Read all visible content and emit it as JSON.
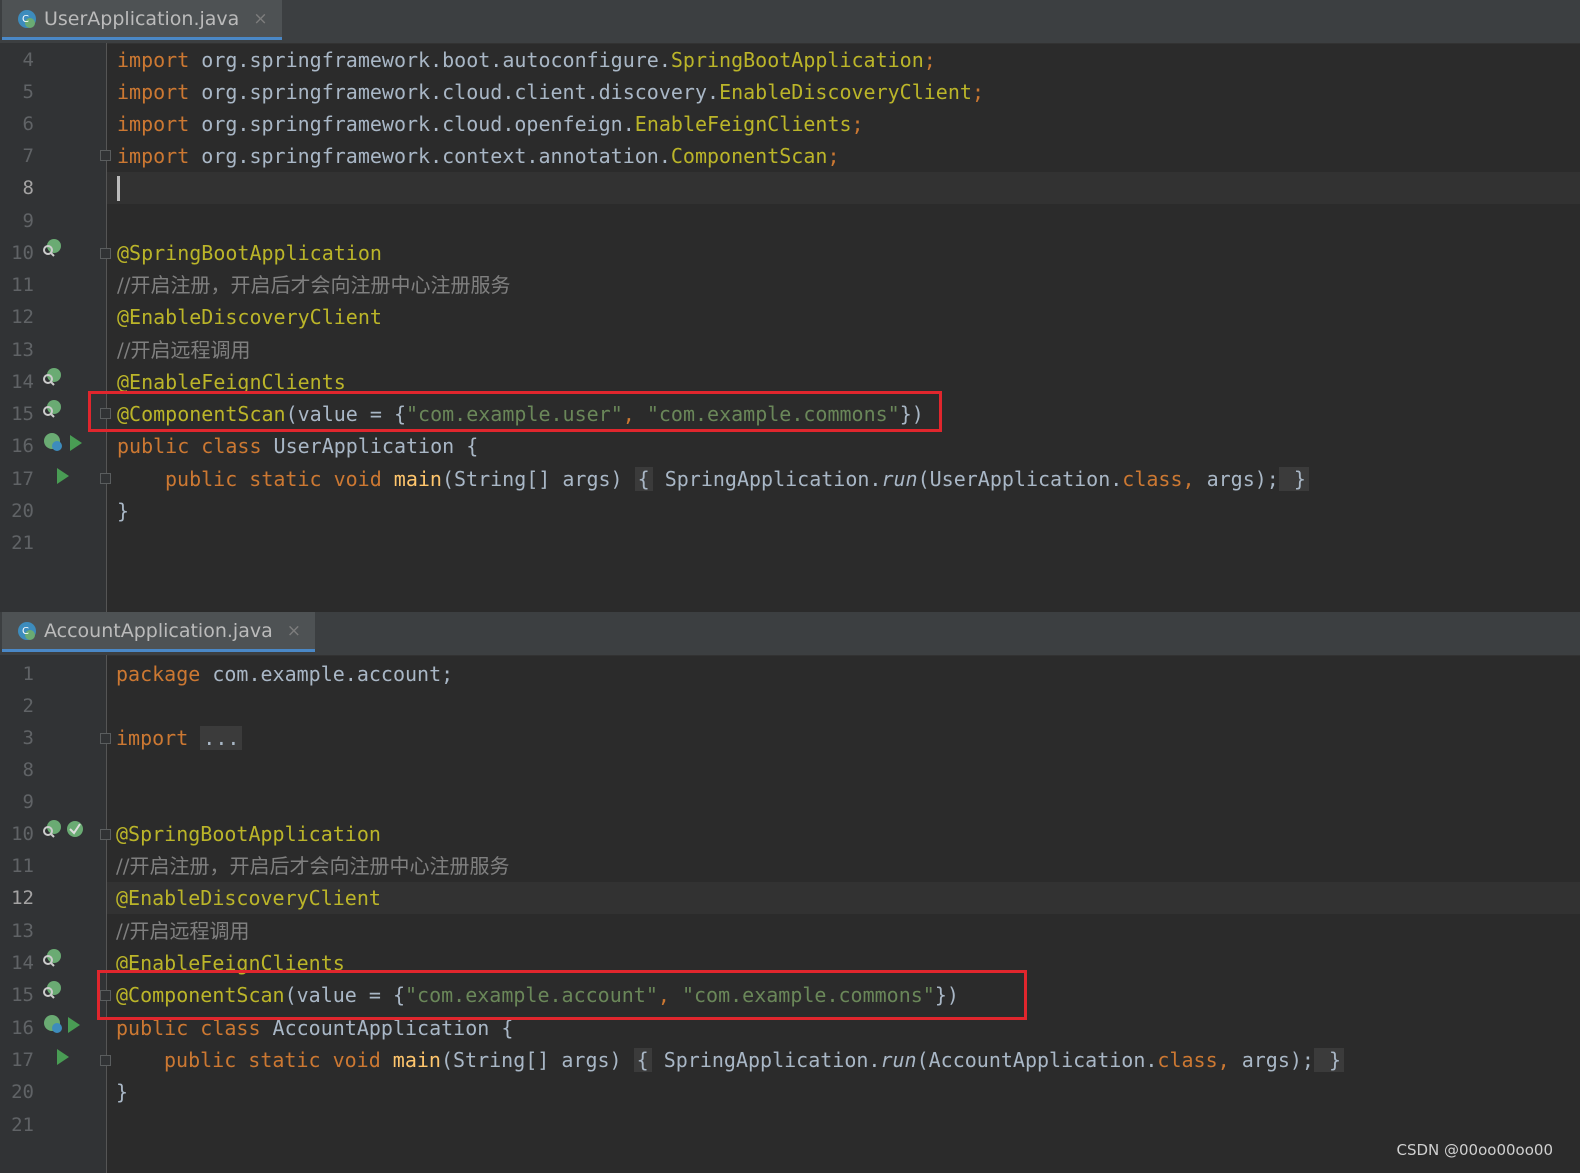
{
  "top_tab": {
    "filename": "UserApplication.java",
    "close": "×"
  },
  "bottom_tab": {
    "filename": "AccountApplication.java",
    "close": "×"
  },
  "top_lines": [
    {
      "num": "4"
    },
    {
      "num": "5"
    },
    {
      "num": "6"
    },
    {
      "num": "7"
    },
    {
      "num": "8"
    },
    {
      "num": "9"
    },
    {
      "num": "10"
    },
    {
      "num": "11"
    },
    {
      "num": "12"
    },
    {
      "num": "13"
    },
    {
      "num": "14"
    },
    {
      "num": "15"
    },
    {
      "num": "16"
    },
    {
      "num": "17"
    },
    {
      "num": "20"
    },
    {
      "num": "21"
    }
  ],
  "bottom_lines": [
    {
      "num": "1"
    },
    {
      "num": "2"
    },
    {
      "num": "3"
    },
    {
      "num": "8"
    },
    {
      "num": "9"
    },
    {
      "num": "10"
    },
    {
      "num": "11"
    },
    {
      "num": "12"
    },
    {
      "num": "13"
    },
    {
      "num": "14"
    },
    {
      "num": "15"
    },
    {
      "num": "16"
    },
    {
      "num": "17"
    },
    {
      "num": "20"
    },
    {
      "num": "21"
    }
  ],
  "top_code": {
    "l4_kw": "import",
    "l4_pkg": " org.springframework.boot.autoconfigure.",
    "l4_cls": "SpringBootApplication",
    "l4_end": ";",
    "l5_kw": "import",
    "l5_pkg": " org.springframework.cloud.client.discovery.",
    "l5_cls": "EnableDiscoveryClient",
    "l5_end": ";",
    "l6_kw": "import",
    "l6_pkg": " org.springframework.cloud.openfeign.",
    "l6_cls": "EnableFeignClients",
    "l6_end": ";",
    "l7_kw": "import",
    "l7_pkg": " org.springframework.context.annotation.",
    "l7_cls": "ComponentScan",
    "l7_end": ";",
    "l10": "@SpringBootApplication",
    "l11": "//开启注册，开启后才会向注册中心注册服务",
    "l12": "@EnableDiscoveryClient",
    "l13": "//开启远程调用",
    "l14": "@EnableFeignClients",
    "l15_ann": "@ComponentScan",
    "l15_a": "(value = {",
    "l15_s1": "\"com.example.user\"",
    "l15_comma": ", ",
    "l15_s2": "\"com.example.commons\"",
    "l15_b": "})",
    "l16_kw": "public class",
    "l16_rest": " UserApplication {",
    "l17_kw": "public static void",
    "l17_main": " main",
    "l17_args": "(String[] args) ",
    "l17_ob": "{",
    "l17_call": " SpringApplication.",
    "l17_run": "run",
    "l17_p": "(UserApplication.",
    "l17_class": "class",
    "l17_c2": ", ",
    "l17_args2": "args);",
    "l17_cb": " }",
    "l20": "}"
  },
  "bottom_code": {
    "l1_kw": "package",
    "l1_rest": " com.example.account;",
    "l3_kw": "import",
    "l3_fold": "...",
    "l10": "@SpringBootApplication",
    "l11": "//开启注册，开启后才会向注册中心注册服务",
    "l12": "@EnableDiscoveryClient",
    "l13": "//开启远程调用",
    "l14": "@EnableFeignClients",
    "l15_ann": "@ComponentScan",
    "l15_a": "(value = {",
    "l15_s1": "\"com.example.account\"",
    "l15_comma": ", ",
    "l15_s2": "\"com.example.commons\"",
    "l15_b": "})",
    "l16_kw": "public class",
    "l16_rest": " AccountApplication {",
    "l17_kw": "public static void",
    "l17_main": " main",
    "l17_args": "(String[] args) ",
    "l17_ob": "{",
    "l17_call": " SpringApplication.",
    "l17_run": "run",
    "l17_p": "(AccountApplication.",
    "l17_class": "class",
    "l17_c2": ", ",
    "l17_args2": "args);",
    "l17_cb": " }",
    "l20": "}"
  },
  "watermark": "CSDN @00oo00oo00",
  "icons": {
    "spring_bean": "spring-bean-icon",
    "run": "run-icon",
    "fold": "fold-icon",
    "java_class": "java-class-icon"
  },
  "colors": {
    "keyword": "#cc7832",
    "annotation": "#bbb529",
    "string": "#6a8759",
    "comment": "#808080",
    "highlight_box": "#e0262d"
  }
}
